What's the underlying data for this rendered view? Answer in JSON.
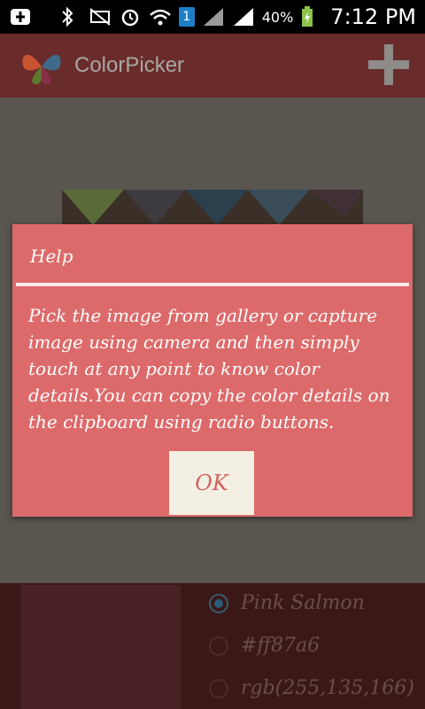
{
  "status_bar": {
    "battery": "40%",
    "time": "7:12 PM",
    "sim_slot": "1",
    "icons": [
      "usb-icon",
      "bluetooth-icon",
      "mute-icon",
      "alarm-icon",
      "wifi-icon",
      "sim-icon",
      "signal-icon",
      "battery-icon"
    ]
  },
  "app_bar": {
    "title": "ColorPicker",
    "add_icon": "plus-icon"
  },
  "dialog": {
    "title": "Help",
    "body": "Pick the image from gallery or capture image using camera and then simply touch at any point to know color details.You can copy the color details on the clipboard using radio buttons.",
    "ok_label": "OK"
  },
  "color_details": {
    "swatch_color": "#ff87a6",
    "options": [
      {
        "label": "Pink Salmon",
        "checked": true
      },
      {
        "label": "#ff87a6",
        "checked": false
      },
      {
        "label": "rgb(255,135,166)",
        "checked": false
      }
    ]
  },
  "colors": {
    "dialog_bg": "#dd6a6a",
    "app_bar_bg": "#6a2b2b",
    "ok_button_bg": "#f4efe3"
  }
}
